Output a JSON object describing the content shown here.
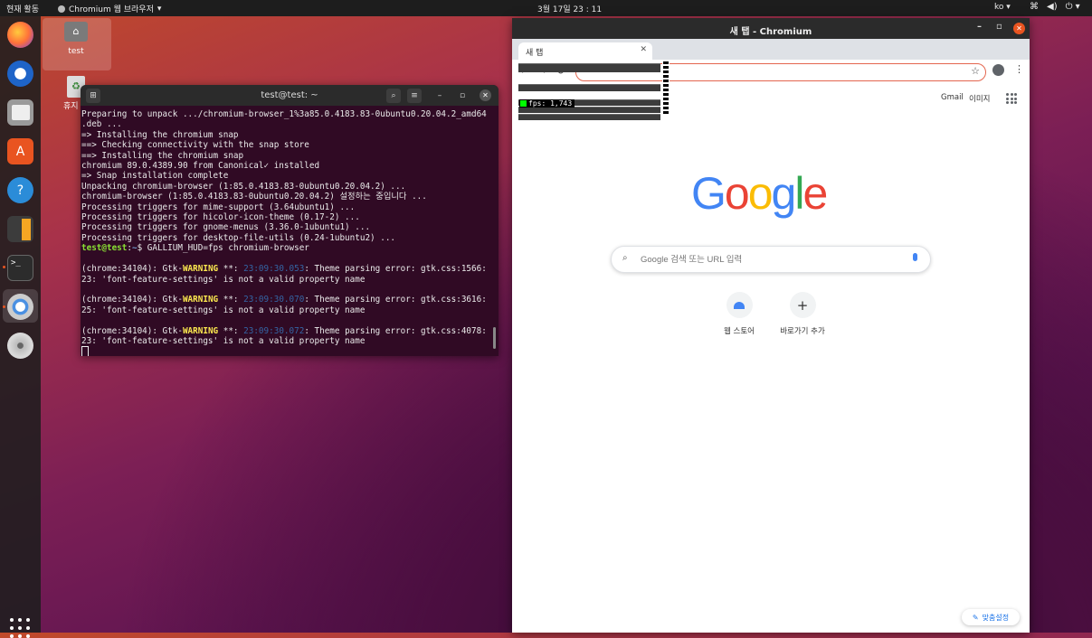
{
  "topbar": {
    "activities": "현재 활동",
    "app_menu": "Chromium 웹 브라우저",
    "clock": "3월 17일  23 : 11",
    "language": "ko",
    "tray_icons": [
      "network-icon",
      "volume-icon",
      "power-icon"
    ]
  },
  "dock": {
    "items": [
      "firefox-icon",
      "thunderbird-icon",
      "files-icon",
      "software-icon",
      "help-icon",
      "calculator-icon",
      "terminal-icon",
      "chromium-icon",
      "disc-icon"
    ],
    "show_apps": "show-apps-icon"
  },
  "desktop": {
    "home_folder_label": "test",
    "trash_label": "휴지"
  },
  "terminal": {
    "title": "test@test: ~",
    "lines": [
      "Preparing to unpack .../chromium-browser_1%3a85.0.4183.83-0ubuntu0.20.04.2_amd64",
      ".deb ...",
      "=> Installing the chromium snap",
      "==> Checking connectivity with the snap store",
      "==> Installing the chromium snap",
      "chromium 89.0.4389.90 from Canonical✓ installed",
      "=> Snap installation complete",
      "Unpacking chromium-browser (1:85.0.4183.83-0ubuntu0.20.04.2) ...",
      "chromium-browser (1:85.0.4183.83-0ubuntu0.20.04.2) 설정하는 중입니다 ...",
      "Processing triggers for mime-support (3.64ubuntu1) ...",
      "Processing triggers for hicolor-icon-theme (0.17-2) ...",
      "Processing triggers for gnome-menus (3.36.0-1ubuntu1) ...",
      "Processing triggers for desktop-file-utils (0.24-1ubuntu2) ..."
    ],
    "prompt_user": "test@test",
    "prompt_sep": ":",
    "prompt_path": "~",
    "prompt_cmd": "$ GALLIUM_HUD=fps chromium-browser",
    "warnings": [
      {
        "pre": "(chrome:34104): Gtk-",
        "level": "WARNING",
        "mid": " **: ",
        "time": "23:09:30.053",
        "msg": ": Theme parsing error: gtk.css:1566:",
        "msg2": "23: 'font-feature-settings' is not a valid property name"
      },
      {
        "pre": "(chrome:34104): Gtk-",
        "level": "WARNING",
        "mid": " **: ",
        "time": "23:09:30.070",
        "msg": ": Theme parsing error: gtk.css:3616:",
        "msg2": "25: 'font-feature-settings' is not a valid property name"
      },
      {
        "pre": "(chrome:34104): Gtk-",
        "level": "WARNING",
        "mid": " **: ",
        "time": "23:09:30.072",
        "msg": ": Theme parsing error: gtk.css:4078:",
        "msg2": "23: 'font-feature-settings' is not a valid property name"
      }
    ]
  },
  "chromium": {
    "window_title": "새 탭 - Chromium",
    "tab_label": "새 탭",
    "omnibox_value": "",
    "hud_fps": "fps: 1,743",
    "ntp": {
      "gmail": "Gmail",
      "images": "이미지",
      "logo_letters": [
        "G",
        "o",
        "o",
        "g",
        "l",
        "e"
      ],
      "logo_colors": [
        "#4285f4",
        "#ea4335",
        "#fbbc05",
        "#4285f4",
        "#34a853",
        "#ea4335"
      ],
      "search_placeholder": "Google 검색 또는 URL 입력",
      "shortcuts": [
        {
          "label": "웹 스토어",
          "icon": "webstore-icon"
        },
        {
          "label": "바로가기 추가",
          "icon": "plus-icon"
        }
      ],
      "customize": "맞춤설정"
    }
  }
}
